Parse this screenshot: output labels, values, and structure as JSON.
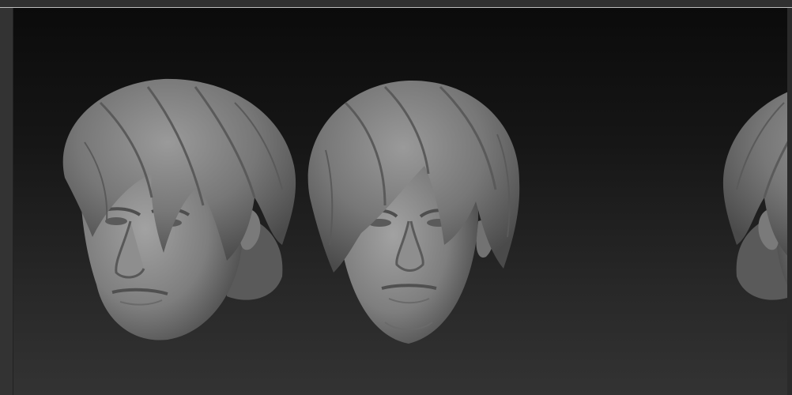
{
  "app": {
    "name": "",
    "viewport": {
      "background_top": "#0b0b0b",
      "background_bottom": "#333333",
      "objects": [
        {
          "name": "head-sculpt-left-view",
          "icon": "head-sculpt-icon",
          "view": "three-quarter-left"
        },
        {
          "name": "head-sculpt-front-view",
          "icon": "head-sculpt-icon",
          "view": "front"
        },
        {
          "name": "head-sculpt-right-view",
          "icon": "head-sculpt-icon",
          "view": "three-quarter-right"
        }
      ],
      "material_color": "#8e8e8e"
    }
  }
}
